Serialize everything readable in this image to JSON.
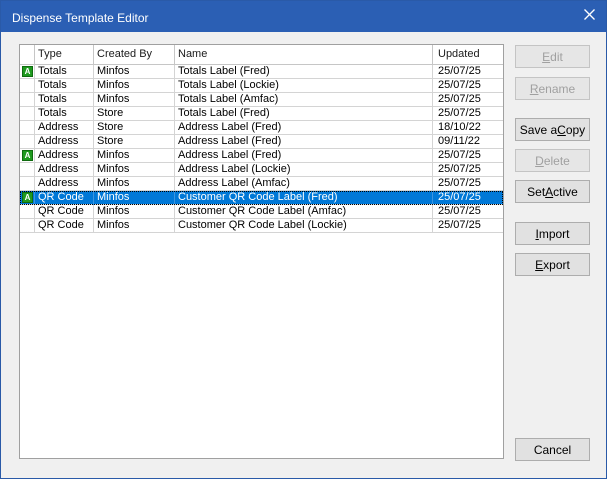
{
  "window": {
    "title": "Dispense Template Editor"
  },
  "grid": {
    "columns": [
      "",
      "Type",
      "Created By",
      "Name",
      "Updated"
    ],
    "active_marker": "A",
    "rows": [
      {
        "active": true,
        "type": "Totals",
        "created_by": "Minfos",
        "name": "Totals Label (Fred)",
        "updated": "25/07/25",
        "selected": false
      },
      {
        "active": false,
        "type": "Totals",
        "created_by": "Minfos",
        "name": "Totals Label (Lockie)",
        "updated": "25/07/25",
        "selected": false
      },
      {
        "active": false,
        "type": "Totals",
        "created_by": "Minfos",
        "name": "Totals Label (Amfac)",
        "updated": "25/07/25",
        "selected": false
      },
      {
        "active": false,
        "type": "Totals",
        "created_by": "Store",
        "name": "Totals Label (Fred)",
        "updated": "25/07/25",
        "selected": false
      },
      {
        "active": false,
        "type": "Address",
        "created_by": "Store",
        "name": "Address Label (Fred)",
        "updated": "18/10/22",
        "selected": false
      },
      {
        "active": false,
        "type": "Address",
        "created_by": "Store",
        "name": "Address Label (Fred)",
        "updated": "09/11/22",
        "selected": false
      },
      {
        "active": true,
        "type": "Address",
        "created_by": "Minfos",
        "name": "Address Label (Fred)",
        "updated": "25/07/25",
        "selected": false
      },
      {
        "active": false,
        "type": "Address",
        "created_by": "Minfos",
        "name": "Address Label (Lockie)",
        "updated": "25/07/25",
        "selected": false
      },
      {
        "active": false,
        "type": "Address",
        "created_by": "Minfos",
        "name": "Address Label (Amfac)",
        "updated": "25/07/25",
        "selected": false
      },
      {
        "active": true,
        "type": "QR Code",
        "created_by": "Minfos",
        "name": "Customer QR Code Label (Fred)",
        "updated": "25/07/25",
        "selected": true
      },
      {
        "active": false,
        "type": "QR Code",
        "created_by": "Minfos",
        "name": "Customer QR Code Label (Amfac)",
        "updated": "25/07/25",
        "selected": false
      },
      {
        "active": false,
        "type": "QR Code",
        "created_by": "Minfos",
        "name": "Customer QR Code Label (Lockie)",
        "updated": "25/07/25",
        "selected": false
      }
    ]
  },
  "buttons": {
    "edit": {
      "pre": "",
      "key": "E",
      "post": "dit",
      "enabled": false
    },
    "rename": {
      "pre": "",
      "key": "R",
      "post": "ename",
      "enabled": false
    },
    "save_copy": {
      "pre": "Save a ",
      "key": "C",
      "post": "opy",
      "enabled": true
    },
    "delete": {
      "pre": "",
      "key": "D",
      "post": "elete",
      "enabled": false
    },
    "set_active": {
      "pre": "Set ",
      "key": "A",
      "post": "ctive",
      "enabled": true
    },
    "import": {
      "pre": "",
      "key": "I",
      "post": "mport",
      "enabled": true
    },
    "export": {
      "pre": "",
      "key": "E",
      "post": "xport",
      "enabled": true
    },
    "cancel": {
      "pre": "Cancel",
      "key": "",
      "post": "",
      "enabled": true
    }
  },
  "icons": {
    "close": "close-icon",
    "active": "active-template-icon"
  },
  "colors": {
    "titlebar": "#2b5fb4",
    "selection": "#0078d7",
    "active_badge": "#1e9a1e"
  }
}
